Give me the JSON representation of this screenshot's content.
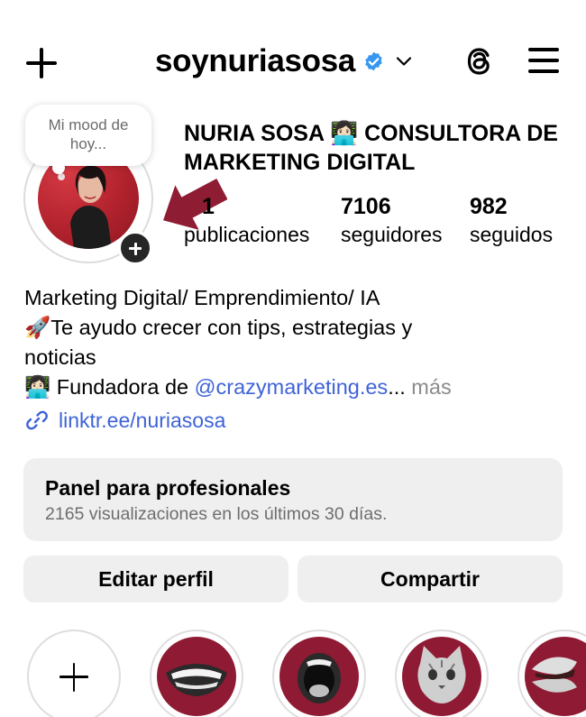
{
  "header": {
    "username": "soynuriasosa",
    "icons": [
      "plus-icon",
      "verified-badge-icon",
      "chevron-down-icon",
      "threads-icon",
      "hamburger-menu-icon"
    ]
  },
  "note": {
    "text": "Mi mood de hoy..."
  },
  "profile": {
    "full_name": "NURIA SOSA 👩🏻‍💻 CONSULTORA DE MARKETING DIGITAL",
    "stats": {
      "posts": {
        "value": "1",
        "label": "publicaciones"
      },
      "followers": {
        "value": "7106",
        "label": "seguidores"
      },
      "following": {
        "value": "982",
        "label": "seguidos"
      }
    }
  },
  "bio": {
    "line1": "Marketing Digital/ Emprendimiento/ IA",
    "line2": "🚀Te ayudo crecer con tips, estrategias y",
    "line3": "noticias",
    "line4_prefix": "👩🏻‍💻 Fundadora de ",
    "mention": "@crazymarketing.es",
    "ellipsis": "...",
    "more": " más",
    "link": "linktr.ee/nuriasosa"
  },
  "panel": {
    "title": "Panel para profesionales",
    "subtitle": "2165 visualizaciones en los últimos 30 días."
  },
  "buttons": {
    "edit": "Editar perfil",
    "share": "Compartir"
  },
  "highlights": [
    "new",
    "mouth",
    "shouting-mouth",
    "cat",
    "lips"
  ],
  "colors": {
    "accent_link": "#3f63d8",
    "verified": "#3797f0",
    "highlight_bg": "#8f1a33",
    "arrow": "#8e1d33",
    "button_bg": "#efefef"
  }
}
